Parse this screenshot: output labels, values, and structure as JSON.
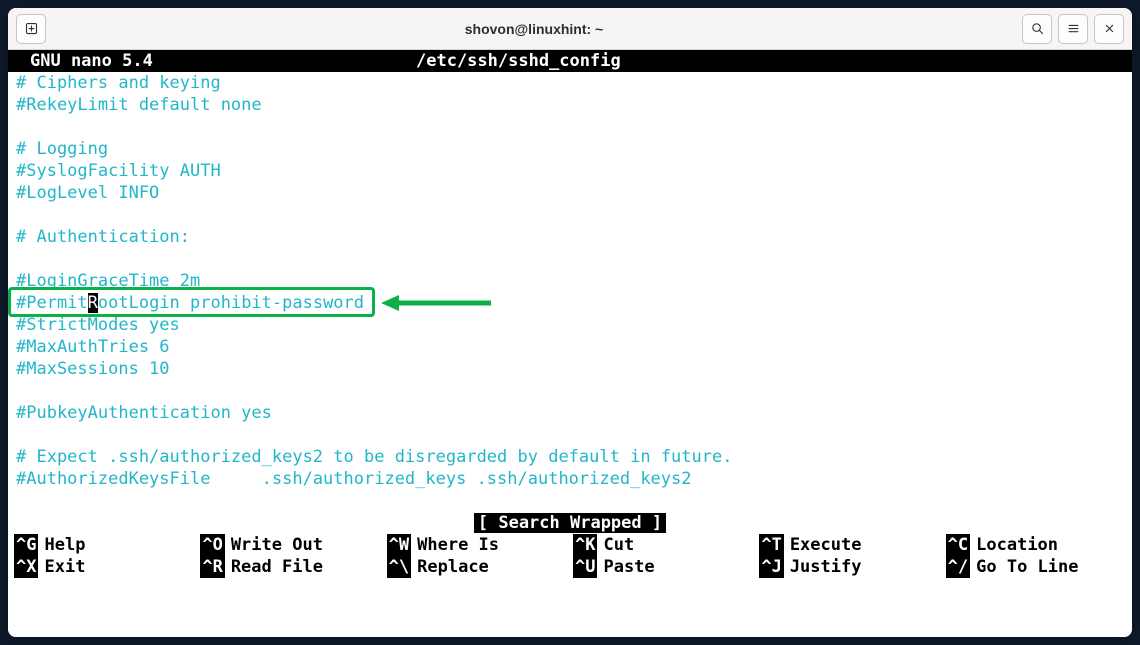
{
  "titlebar": {
    "title": "shovon@linuxhint: ~"
  },
  "editor": {
    "app_label": "GNU nano 5.4",
    "filename": "/etc/ssh/sshd_config",
    "lines": [
      "# Ciphers and keying",
      "#RekeyLimit default none",
      "",
      "# Logging",
      "#SyslogFacility AUTH",
      "#LogLevel INFO",
      "",
      "# Authentication:",
      "",
      "#LoginGraceTime 2m",
      "#PermitRootLogin prohibit-password",
      "#StrictModes yes",
      "#MaxAuthTries 6",
      "#MaxSessions 10",
      "",
      "#PubkeyAuthentication yes",
      "",
      "# Expect .ssh/authorized_keys2 to be disregarded by default in future.",
      "#AuthorizedKeysFile     .ssh/authorized_keys .ssh/authorized_keys2",
      ""
    ],
    "highlighted_line_index": 10,
    "cursor_line_index": 10,
    "cursor_col": 7,
    "message": "[ Search Wrapped ]"
  },
  "shortcuts": [
    {
      "key": "^G",
      "label": "Help"
    },
    {
      "key": "^O",
      "label": "Write Out"
    },
    {
      "key": "^W",
      "label": "Where Is"
    },
    {
      "key": "^K",
      "label": "Cut"
    },
    {
      "key": "^T",
      "label": "Execute"
    },
    {
      "key": "^C",
      "label": "Location"
    },
    {
      "key": "^X",
      "label": "Exit"
    },
    {
      "key": "^R",
      "label": "Read File"
    },
    {
      "key": "^\\",
      "label": "Replace"
    },
    {
      "key": "^U",
      "label": "Paste"
    },
    {
      "key": "^J",
      "label": "Justify"
    },
    {
      "key": "^/",
      "label": "Go To Line"
    }
  ]
}
